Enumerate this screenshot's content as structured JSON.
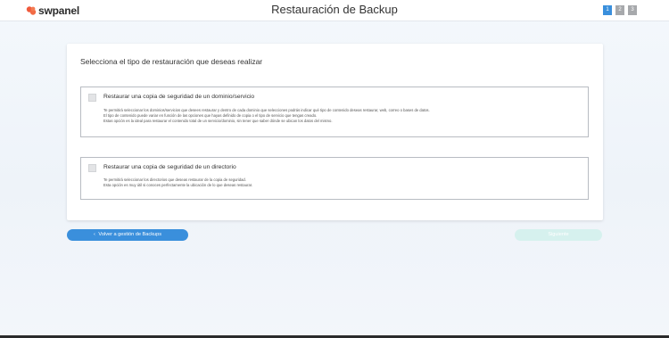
{
  "brand": {
    "name": "swpanel",
    "accent": "#f05a3c"
  },
  "header": {
    "title": "Restauración de Backup",
    "steps": [
      "1",
      "2",
      "3"
    ],
    "active_step": 1
  },
  "card": {
    "title": "Selecciona el tipo de restauración que deseas realizar",
    "options": [
      {
        "title": "Restaurar una copia de seguridad de un dominio/servicio",
        "checked": false,
        "description": [
          "Te permitirá seleccionar los dominios/servicios que desees restaurar y dentro de cada dominio que selecciones podrás indicar qué tipo de contenido deseas restaurar, web, correo o bases de datos.",
          "El tipo de contenido puede variar en función de las opciones que hayas definido de copia o el tipo de servicio que tengas creado.",
          "Estas opción es la ideal para restaurar el contenido total de un servicio/dominio, sin tener que saber dónde se ubican los datos del mismo."
        ]
      },
      {
        "title": "Restaurar una copia de seguridad de un directorio",
        "checked": false,
        "description": [
          "Te permitirá seleccionar los directorios que deseas restaurar de la copia de seguridad.",
          "Esta opción es muy útil si conoces perfectamente la ubicación de lo que deseas restaurar."
        ]
      }
    ]
  },
  "actions": {
    "back_label": "Volver a gestión de Backups",
    "back_icon": "chevron-left-icon",
    "next_label": "Siguiente",
    "primary_color": "#3a8fdc",
    "disabled_color": "#d6f1ee"
  }
}
